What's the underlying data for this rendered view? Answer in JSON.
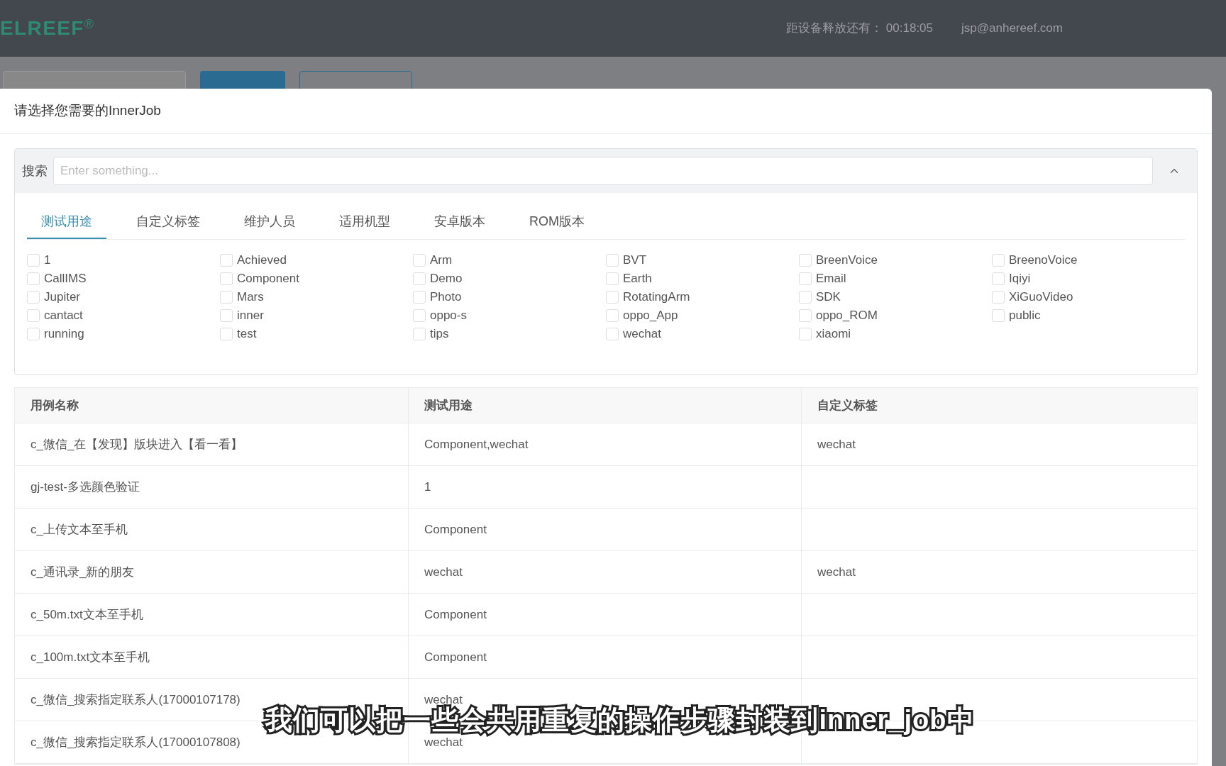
{
  "header": {
    "logo": "ELREEF",
    "logo_mark": "®",
    "countdown_label": "距设备释放还有：",
    "countdown": "00:18:05",
    "user": "jsp@anhereef.com"
  },
  "background": {
    "buttons": [
      {
        "kind": "primary"
      },
      {
        "kind": "outline"
      }
    ]
  },
  "modal": {
    "title": "请选择您需要的InnerJob",
    "search": {
      "label": "搜索",
      "placeholder": "Enter something...",
      "expanded": true
    },
    "tabs": [
      {
        "label": "测试用途",
        "selected": true
      },
      {
        "label": "自定义标签",
        "selected": false
      },
      {
        "label": "维护人员",
        "selected": false
      },
      {
        "label": "适用机型",
        "selected": false
      },
      {
        "label": "安卓版本",
        "selected": false
      },
      {
        "label": "ROM版本",
        "selected": false
      }
    ],
    "options": [
      {
        "label": "1",
        "checked": false
      },
      {
        "label": "Achieved",
        "checked": false
      },
      {
        "label": "Arm",
        "checked": false
      },
      {
        "label": "BVT",
        "checked": false
      },
      {
        "label": "BreenVoice",
        "checked": false
      },
      {
        "label": "BreenoVoice",
        "checked": false
      },
      {
        "label": "CallIMS",
        "checked": false
      },
      {
        "label": "Component",
        "checked": false
      },
      {
        "label": "Demo",
        "checked": false
      },
      {
        "label": "Earth",
        "checked": false
      },
      {
        "label": "Email",
        "checked": false
      },
      {
        "label": "Iqiyi",
        "checked": false
      },
      {
        "label": "Jupiter",
        "checked": false
      },
      {
        "label": "Mars",
        "checked": false
      },
      {
        "label": "Photo",
        "checked": false
      },
      {
        "label": "RotatingArm",
        "checked": false
      },
      {
        "label": "SDK",
        "checked": false
      },
      {
        "label": "XiGuoVideo",
        "checked": false
      },
      {
        "label": "cantact",
        "checked": false
      },
      {
        "label": "inner",
        "checked": false
      },
      {
        "label": "oppo-s",
        "checked": false
      },
      {
        "label": "oppo_App",
        "checked": false
      },
      {
        "label": "oppo_ROM",
        "checked": false
      },
      {
        "label": "public",
        "checked": false
      },
      {
        "label": "running",
        "checked": false
      },
      {
        "label": "test",
        "checked": false
      },
      {
        "label": "tips",
        "checked": false
      },
      {
        "label": "wechat",
        "checked": false
      },
      {
        "label": "xiaomi",
        "checked": false
      }
    ],
    "table": {
      "columns": [
        "用例名称",
        "测试用途",
        "自定义标签"
      ],
      "rows": [
        [
          "c_微信_在【发现】版块进入【看一看】",
          "Component,wechat",
          "wechat"
        ],
        [
          "gj-test-多选颜色验证",
          "1",
          ""
        ],
        [
          "c_上传文本至手机",
          "Component",
          ""
        ],
        [
          "c_通讯录_新的朋友",
          "wechat",
          "wechat"
        ],
        [
          "c_50m.txt文本至手机",
          "Component",
          ""
        ],
        [
          "c_100m.txt文本至手机",
          "Component",
          ""
        ],
        [
          "c_微信_搜索指定联系人(17000107178)",
          "wechat",
          ""
        ],
        [
          "c_微信_搜索指定联系人(17000107808)",
          "wechat",
          ""
        ]
      ]
    }
  },
  "subtitle": "我们可以把一些会共用重复的操作步骤封装到inner_job中"
}
